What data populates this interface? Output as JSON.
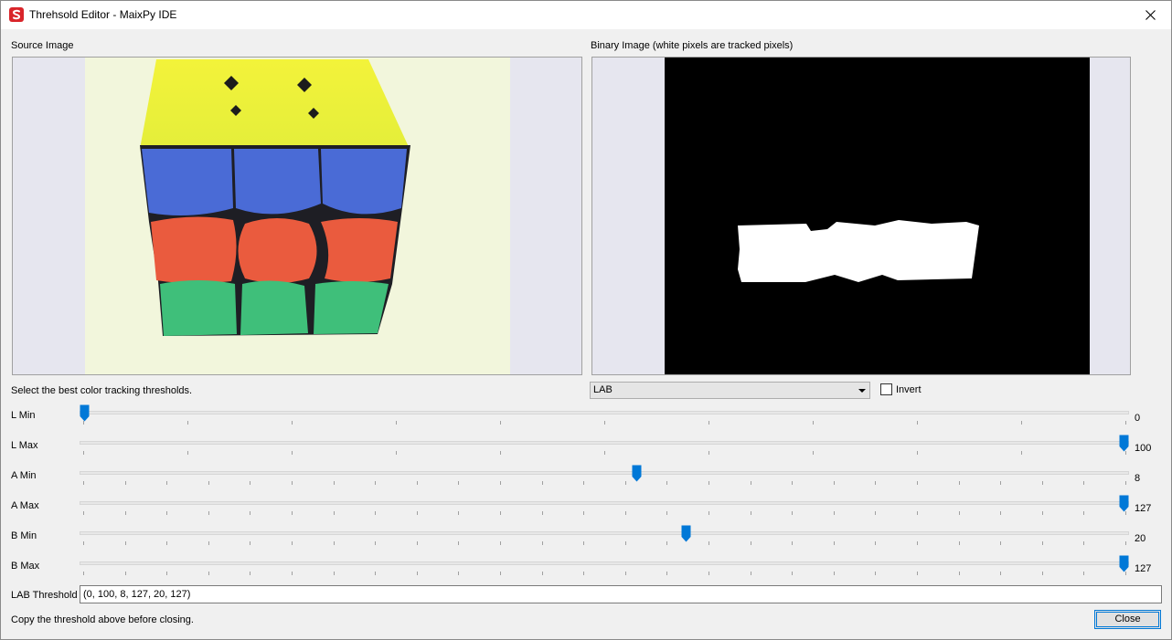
{
  "window": {
    "title": "Threhsold Editor - MaixPy IDE"
  },
  "source": {
    "label": "Source Image"
  },
  "binary": {
    "label": "Binary Image (white pixels are tracked pixels)"
  },
  "instructions": "Select the best color tracking thresholds.",
  "mode": {
    "selected": "LAB"
  },
  "invert": {
    "label": "Invert",
    "checked": false
  },
  "sliders": [
    {
      "label": "L Min",
      "value": "0",
      "fraction": 0.0,
      "ticks": 10
    },
    {
      "label": "L Max",
      "value": "100",
      "fraction": 1.0,
      "ticks": 10
    },
    {
      "label": "A Min",
      "value": "8",
      "fraction": 0.5314,
      "ticks": 25
    },
    {
      "label": "A Max",
      "value": "127",
      "fraction": 1.0,
      "ticks": 25
    },
    {
      "label": "B Min",
      "value": "20",
      "fraction": 0.5784,
      "ticks": 25
    },
    {
      "label": "B Max",
      "value": "127",
      "fraction": 1.0,
      "ticks": 25
    }
  ],
  "threshold": {
    "label": "LAB Threshold",
    "value": "(0, 100, 8, 127, 20, 127)"
  },
  "footer": {
    "note": "Copy the threshold above before closing.",
    "close_label": "Close"
  },
  "colors": {
    "accent": "#0078d7"
  }
}
